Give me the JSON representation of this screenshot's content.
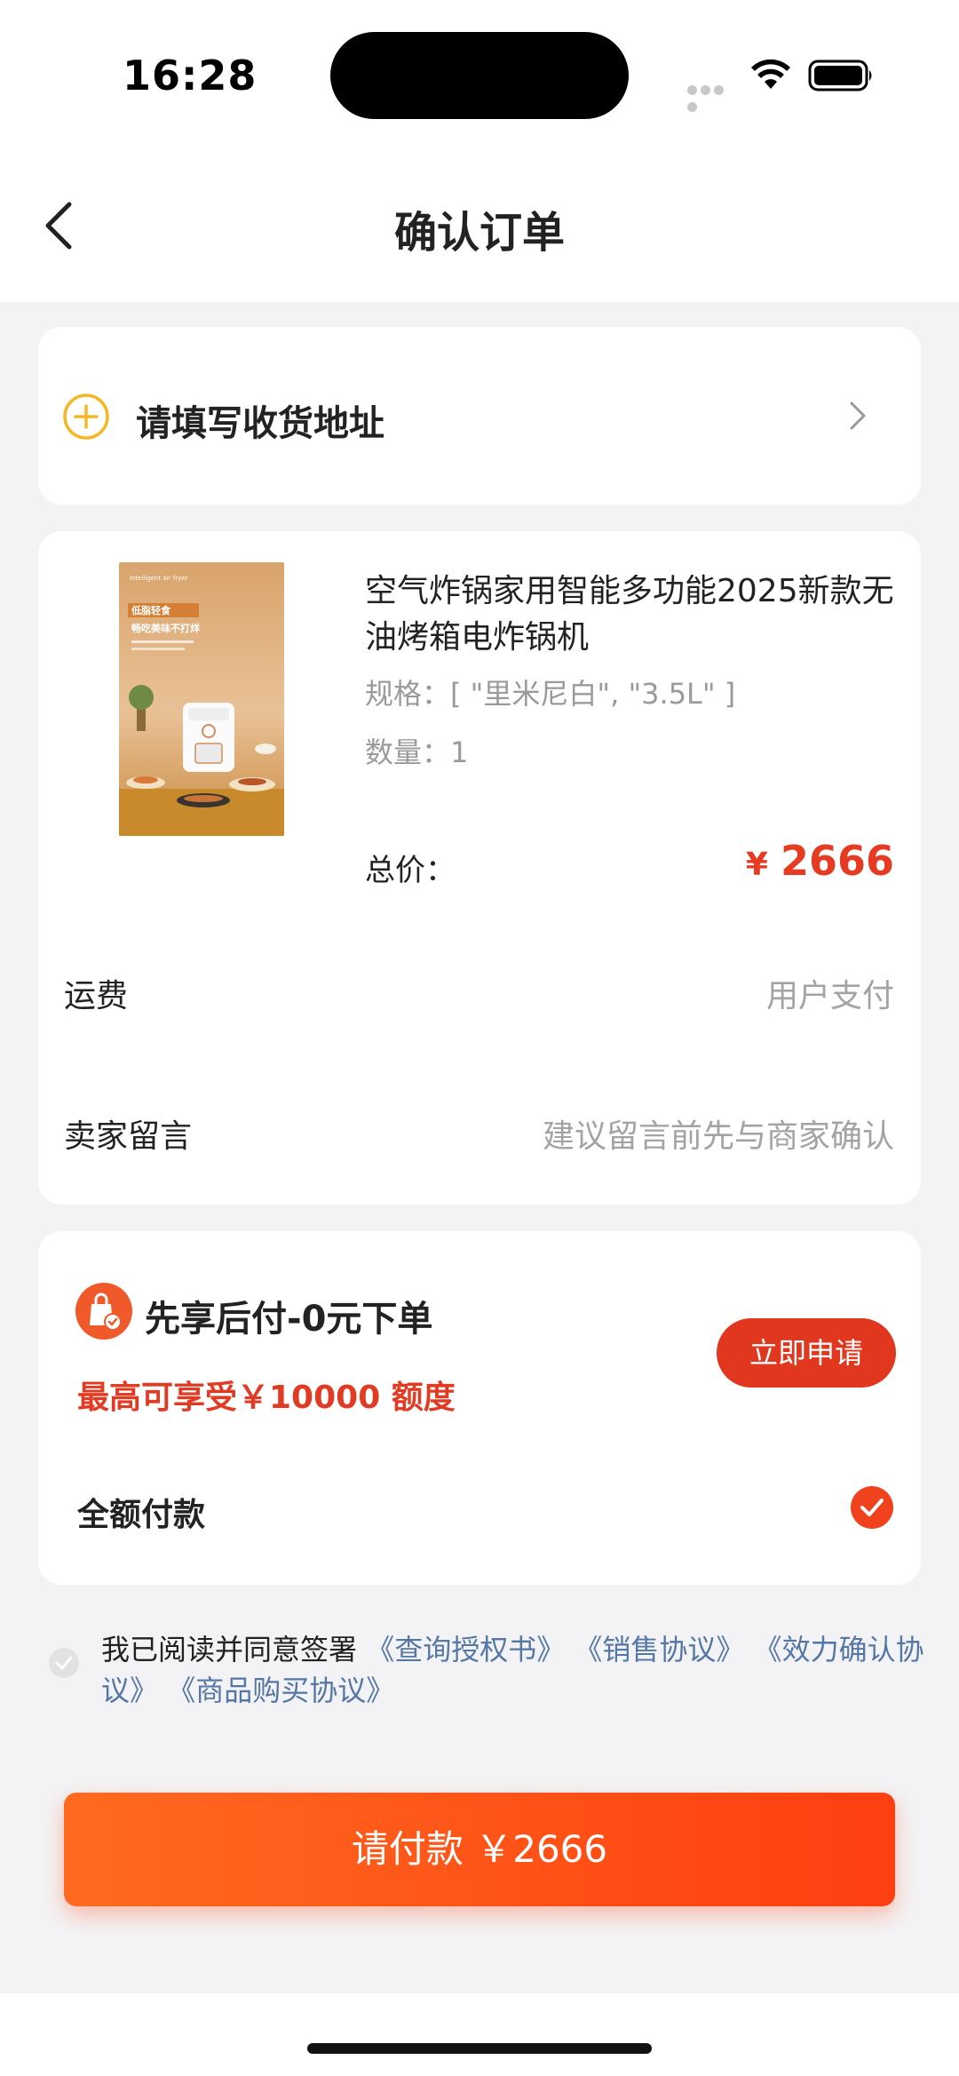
{
  "status_bar": {
    "time": "16:28"
  },
  "nav": {
    "title": "确认订单"
  },
  "address": {
    "label": "请填写收货地址"
  },
  "product": {
    "name": "空气炸锅家用智能多功能2025新款无油烤箱电炸锅机",
    "spec": "规格：[ \"里米尼白\", \"3.5L\" ]",
    "quantity": "数量：1",
    "total_label": "总价：",
    "currency": "¥",
    "total_value": "2666",
    "image_text": {
      "top": "intelligent air fryer",
      "headline1": "低脂轻食",
      "headline2": "畅吃美味不打烊"
    }
  },
  "shipping": {
    "label": "运费",
    "value": "用户支付"
  },
  "seller_message": {
    "label": "卖家留言",
    "placeholder": "建议留言前先与商家确认"
  },
  "payment": {
    "bnpl_title": "先享后付-0元下单",
    "bnpl_subtitle": "最高可享受￥10000 额度",
    "apply_button": "立即申请",
    "full_pay_label": "全额付款"
  },
  "agreement": {
    "prefix": "我已阅读并同意签署",
    "links": [
      "《查询授权书》",
      "《销售协议》",
      "《效力确认协议》",
      "《商品购买协议》"
    ]
  },
  "pay_button": {
    "label": "请付款 ￥2666"
  },
  "colors": {
    "accent": "#e63a22",
    "pay_gradient_start": "#ff6a20",
    "pay_gradient_end": "#ff3f10",
    "link": "#5577a6",
    "address_icon": "#f5b824"
  }
}
